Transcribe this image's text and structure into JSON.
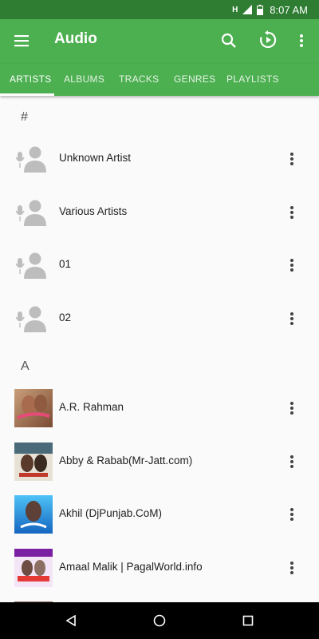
{
  "status_bar": {
    "time": "8:07 AM",
    "network": "H"
  },
  "app_bar": {
    "title": "Audio",
    "menu_icon": "hamburger-menu-icon",
    "search_icon": "search-icon",
    "resume_icon": "resume-playback-icon",
    "overflow_icon": "overflow-menu-icon"
  },
  "tabs": [
    {
      "label": "ARTISTS",
      "active": true
    },
    {
      "label": "ALBUMS",
      "active": false
    },
    {
      "label": "TRACKS",
      "active": false
    },
    {
      "label": "GENRES",
      "active": false
    },
    {
      "label": "PLAYLISTS",
      "active": false
    }
  ],
  "sections": [
    {
      "header": "#",
      "items": [
        {
          "name": "Unknown Artist",
          "image": "artist-placeholder-icon"
        },
        {
          "name": "Various Artists",
          "image": "artist-placeholder-icon"
        },
        {
          "name": "01",
          "image": "artist-placeholder-icon"
        },
        {
          "name": "02",
          "image": "artist-placeholder-icon"
        }
      ]
    },
    {
      "header": "A",
      "items": [
        {
          "name": "A.R. Rahman",
          "image": "album-art"
        },
        {
          "name": "Abby & Rabab(Mr-Jatt.com)",
          "image": "album-art"
        },
        {
          "name": "Akhil (DjPunjab.CoM)",
          "image": "album-art"
        },
        {
          "name": "Amaal Malik | PagalWorld.info",
          "image": "album-art"
        }
      ]
    }
  ],
  "colors": {
    "primary": "#4caf50",
    "status_bar": "#2e7d32",
    "background": "#fafafa",
    "icon_gray": "#bdbdbd"
  }
}
